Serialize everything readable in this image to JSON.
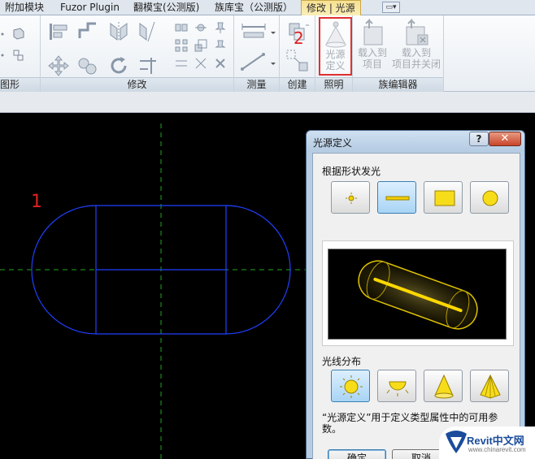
{
  "ribbon": {
    "tabs": [
      {
        "label": "附加模块",
        "active": false,
        "contextual": false
      },
      {
        "label": "Fuzor Plugin",
        "active": false,
        "contextual": false
      },
      {
        "label": "翻模宝(公测版)",
        "active": false,
        "contextual": false
      },
      {
        "label": "族库宝（公测版）",
        "active": false,
        "contextual": false
      },
      {
        "label": "修改 | 光源",
        "active": true,
        "contextual": true
      }
    ],
    "panels": {
      "geometry": "图形",
      "modify": "修改",
      "measure": "测量",
      "create": "创建",
      "lighting": "照明",
      "family_editor": "族编辑器"
    },
    "buttons": {
      "light_definition": [
        "光源",
        "定义"
      ],
      "load_into_project": [
        "载入到",
        "项目"
      ],
      "load_into_project_close": [
        "载入到",
        "项目并关闭"
      ]
    },
    "markers": {
      "ribbon": "2",
      "canvas": "1"
    }
  },
  "dialog": {
    "title": "光源定义",
    "help_label": "?",
    "close_label": "✕",
    "emit_from_shape_label": "根据形状发光",
    "emit_shapes": [
      {
        "name": "point",
        "selected": false
      },
      {
        "name": "line",
        "selected": true
      },
      {
        "name": "rectangle",
        "selected": false
      },
      {
        "name": "circle",
        "selected": false
      }
    ],
    "distribution_label": "光线分布",
    "distributions": [
      {
        "name": "spherical",
        "selected": true
      },
      {
        "name": "hemispherical",
        "selected": false
      },
      {
        "name": "spot",
        "selected": false
      },
      {
        "name": "photometric-web",
        "selected": false
      }
    ],
    "description": "“光源定义”用于定义类型属性中的可用参数。",
    "ok_label": "确定",
    "cancel_label": "取消"
  },
  "watermark": {
    "title": "Revit中文网",
    "url": "www.chinarevit.com"
  },
  "colors": {
    "canvas": "#000000",
    "outline": "#2040ff",
    "centerline": "#1fa31f",
    "light": "#f0d000",
    "marker": "#e02020"
  }
}
